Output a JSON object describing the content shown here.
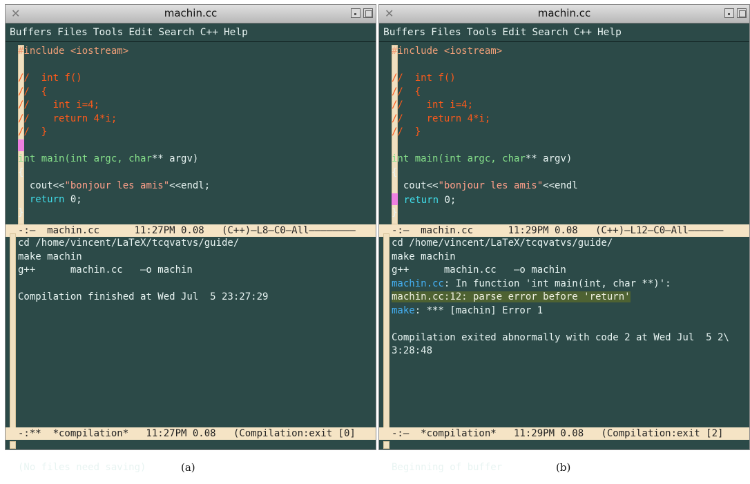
{
  "windows": [
    {
      "title": "machin.cc",
      "menu": [
        "Buffers",
        "Files",
        "Tools",
        "Edit",
        "Search",
        "C++",
        "Help"
      ],
      "code_lines": [
        [
          {
            "t": "#include <iostream>",
            "c": "cpre"
          }
        ],
        [],
        [
          {
            "t": "//  int f()",
            "c": "ccom"
          }
        ],
        [
          {
            "t": "//  {",
            "c": "ccom"
          }
        ],
        [
          {
            "t": "//    int i=4;",
            "c": "ccom"
          }
        ],
        [
          {
            "t": "//    return 4*i;",
            "c": "ccom"
          }
        ],
        [
          {
            "t": "//  }",
            "c": "ccom"
          }
        ],
        [
          {
            "cursor": true
          }
        ],
        [
          {
            "t": "int main(int argc, ",
            "c": "ctyp"
          },
          {
            "t": "char",
            "c": "ctyp"
          },
          {
            "t": "** argv)",
            "c": ""
          }
        ],
        [
          {
            "t": "{",
            "c": ""
          }
        ],
        [
          {
            "t": "  cout<<",
            "c": ""
          },
          {
            "t": "\"bonjour les amis\"",
            "c": "cstr"
          },
          {
            "t": "<<endl;",
            "c": ""
          }
        ],
        [
          {
            "t": "  ",
            "c": ""
          },
          {
            "t": "return",
            "c": "ckw"
          },
          {
            "t": " 0;",
            "c": ""
          }
        ],
        [
          {
            "t": "}",
            "c": ""
          }
        ]
      ],
      "mode_line_code": "-:—  machin.cc      11:27PM 0.08   (C++)—L8—C0—All————————",
      "output_lines": [
        [
          {
            "t": "cd /home/vincent/LaTeX/tcqvatvs/guide/",
            "c": ""
          }
        ],
        [
          {
            "t": "make machin",
            "c": ""
          }
        ],
        [
          {
            "t": "g++      machin.cc   —o machin",
            "c": ""
          }
        ],
        [],
        [
          {
            "t": "Compilation finished at Wed Jul  5 23:27:29",
            "c": ""
          }
        ]
      ],
      "mode_line_comp": "-:**  *compilation*   11:27PM 0.08   (Compilation:exit [0]",
      "echo": "(No files need saving)",
      "caption": "(a)"
    },
    {
      "title": "machin.cc",
      "menu": [
        "Buffers",
        "Files",
        "Tools",
        "Edit",
        "Search",
        "C++",
        "Help"
      ],
      "code_lines": [
        [
          {
            "t": "#include <iostream>",
            "c": "cpre"
          }
        ],
        [],
        [
          {
            "t": "//  int f()",
            "c": "ccom"
          }
        ],
        [
          {
            "t": "//  {",
            "c": "ccom"
          }
        ],
        [
          {
            "t": "//    int i=4;",
            "c": "ccom"
          }
        ],
        [
          {
            "t": "//    return 4*i;",
            "c": "ccom"
          }
        ],
        [
          {
            "t": "//  }",
            "c": "ccom"
          }
        ],
        [],
        [
          {
            "t": "int main(int argc, ",
            "c": "ctyp"
          },
          {
            "t": "char",
            "c": "ctyp"
          },
          {
            "t": "** argv)",
            "c": ""
          }
        ],
        [
          {
            "t": "{",
            "c": ""
          }
        ],
        [
          {
            "t": "  cout<<",
            "c": ""
          },
          {
            "t": "\"bonjour les amis\"",
            "c": "cstr"
          },
          {
            "t": "<<endl",
            "c": ""
          }
        ],
        [
          {
            "cursor": true
          },
          {
            "t": " ",
            "c": ""
          },
          {
            "t": "return",
            "c": "ckw"
          },
          {
            "t": " 0;",
            "c": ""
          }
        ],
        [
          {
            "t": "}",
            "c": ""
          }
        ]
      ],
      "mode_line_code": "-:—  machin.cc      11:29PM 0.08   (C++)—L12—C0—All——————",
      "output_lines": [
        [
          {
            "t": "cd /home/vincent/LaTeX/tcqvatvs/guide/",
            "c": ""
          }
        ],
        [
          {
            "t": "make machin",
            "c": ""
          }
        ],
        [
          {
            "t": "g++      machin.cc   —o machin",
            "c": ""
          }
        ],
        [
          {
            "t": "machin.cc",
            "c": "cfile"
          },
          {
            "t": ": In function 'int main(int, char **)':",
            "c": ""
          }
        ],
        [
          {
            "t": "machin.cc:12: parse error before 'return'",
            "c": "hl"
          }
        ],
        [
          {
            "t": "make",
            "c": "cmake"
          },
          {
            "t": ": *** [machin] Error 1",
            "c": ""
          }
        ],
        [],
        [
          {
            "t": "Compilation exited abnormally with code 2 at Wed Jul  5 2\\",
            "c": ""
          }
        ],
        [
          {
            "t": "3:28:48",
            "c": ""
          }
        ]
      ],
      "mode_line_comp": "-:—  *compilation*   11:29PM 0.08   (Compilation:exit [2]",
      "echo": "Beginning of buffer",
      "caption": "(b)"
    }
  ]
}
